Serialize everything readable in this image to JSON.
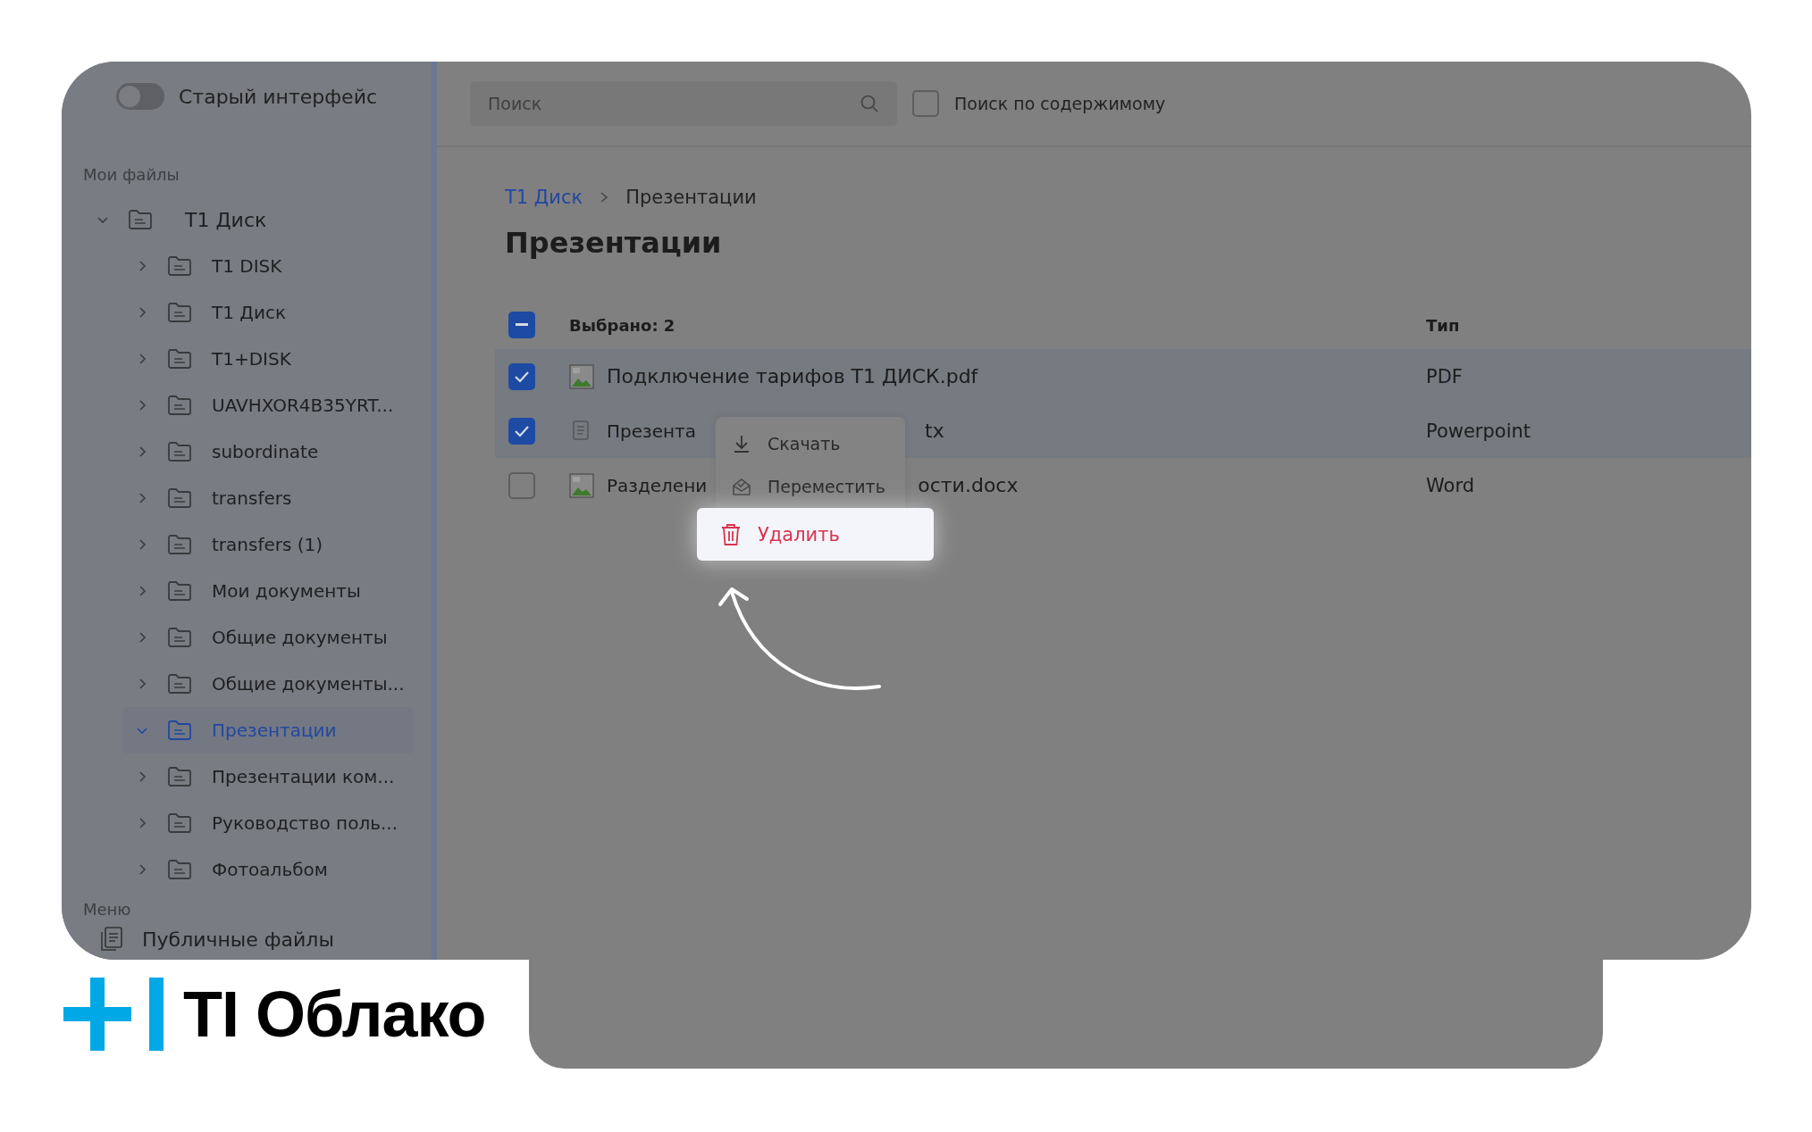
{
  "sidebar": {
    "toggle": {
      "label": "Старый интерфейс",
      "on": false
    },
    "section_title": "Мои файлы",
    "tree": [
      {
        "label": "T1 Диск",
        "expanded": true,
        "selected": false,
        "children": [
          {
            "label": "T1 DISK",
            "expanded": false,
            "selected": false
          },
          {
            "label": "T1 Диск",
            "expanded": false,
            "selected": false
          },
          {
            "label": "T1+DISK",
            "expanded": false,
            "selected": false
          },
          {
            "label": "UAVHXOR4B35YRT...",
            "expanded": false,
            "selected": false
          },
          {
            "label": "subordinate",
            "expanded": false,
            "selected": false
          },
          {
            "label": "transfers",
            "expanded": false,
            "selected": false
          },
          {
            "label": "transfers (1)",
            "expanded": false,
            "selected": false
          },
          {
            "label": "Мои документы",
            "expanded": false,
            "selected": false
          },
          {
            "label": "Общие документы",
            "expanded": false,
            "selected": false
          },
          {
            "label": "Общие документы...",
            "expanded": false,
            "selected": false
          },
          {
            "label": "Презентации",
            "expanded": true,
            "selected": true
          },
          {
            "label": "Презентации ком...",
            "expanded": false,
            "selected": false
          },
          {
            "label": "Руководство поль...",
            "expanded": false,
            "selected": false
          },
          {
            "label": "Фотоальбом",
            "expanded": false,
            "selected": false
          }
        ]
      }
    ],
    "menu_title": "Меню",
    "menu_items": [
      {
        "label": "Публичные файлы"
      }
    ]
  },
  "search": {
    "placeholder": "Поиск"
  },
  "content_search": {
    "label": "Поиск по содержимому",
    "checked": false
  },
  "breadcrumb": [
    {
      "label": "T1 Диск",
      "kind": "link"
    },
    {
      "label": "Презентации",
      "kind": "current"
    }
  ],
  "title": "Презентации",
  "table": {
    "select_all": {
      "checked": true,
      "indeterminate": true
    },
    "selected_count": "Выбрано: 2",
    "type_column": "Тип",
    "rows": [
      {
        "name": "Подключение тарифов T1 ДИСК.pdf",
        "type": "PDF",
        "checked": true,
        "kind": "image"
      },
      {
        "name": "Презента",
        "name_tail": "tx",
        "type": "Powerpoint",
        "checked": true,
        "kind": "document"
      },
      {
        "name": "Разделени",
        "name_tail": "ости.docx",
        "type": "Word",
        "checked": false,
        "kind": "image"
      }
    ]
  },
  "context_menu": [
    {
      "label": "Скачать",
      "kind": "download",
      "highlighted": false
    },
    {
      "label": "Переместить",
      "kind": "move",
      "highlighted": false
    },
    {
      "label": "Удалить",
      "kind": "delete",
      "highlighted": true
    }
  ],
  "logo": {
    "text": "TI Облако"
  }
}
